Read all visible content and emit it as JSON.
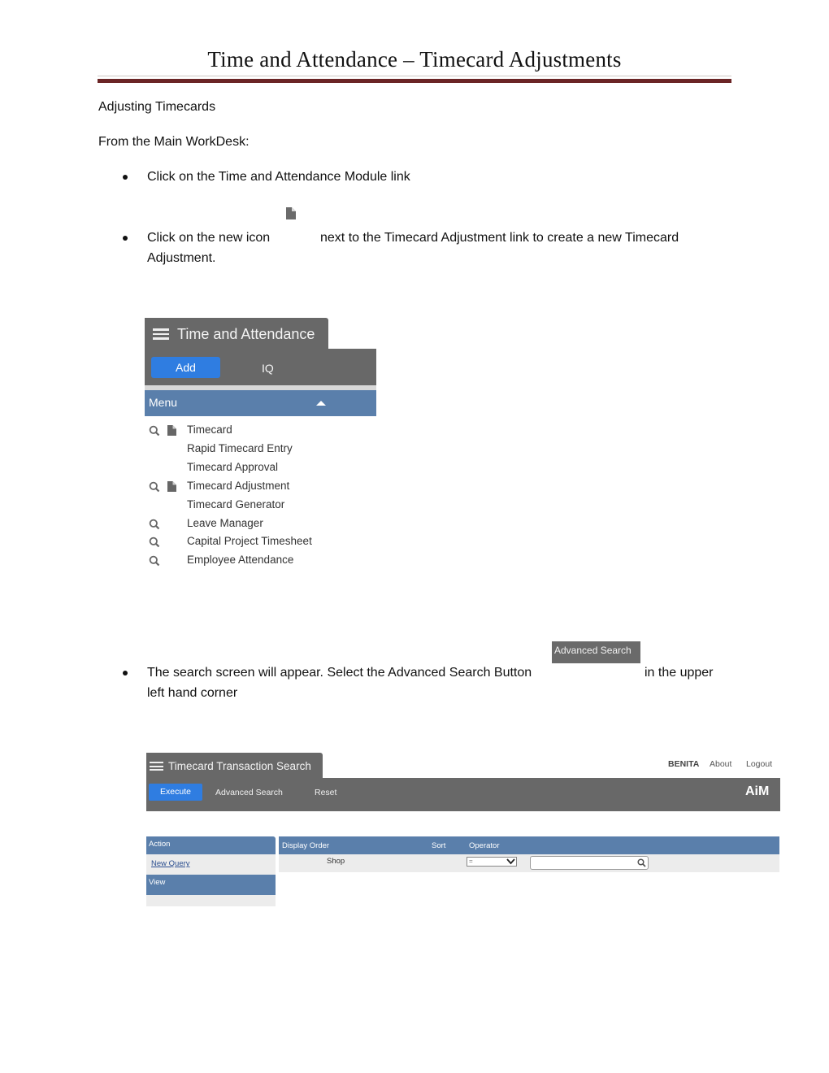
{
  "document": {
    "title": "Time and Attendance – Timecard Adjustments",
    "heading": "Adjusting Timecards",
    "intro": "From the Main WorkDesk:",
    "steps": [
      {
        "text": "Click on the Time and Attendance Module link"
      },
      {
        "text_line1_before": "Click on the new icon",
        "text_line1_after": "next to the Timecard Adjustment link to create a new Timecard",
        "text_line2": "Adjustment.",
        "inline_icon": "new-document-icon"
      },
      {
        "text_line1_before": "The search screen will appear.  Select the Advanced Search Button",
        "text_line1_after": "in the upper",
        "text_line2": "left hand corner",
        "inline_button_label": "Advanced Search"
      }
    ]
  },
  "ta_screenshot": {
    "title": "Time and Attendance",
    "add_label": "Add",
    "iq_label": "IQ",
    "menu_label": "Menu",
    "items": [
      {
        "label": "Timecard",
        "search": true,
        "new": true
      },
      {
        "label": "Rapid Timecard Entry",
        "search": false,
        "new": false
      },
      {
        "label": "Timecard Approval",
        "search": false,
        "new": false
      },
      {
        "label": "Timecard Adjustment",
        "search": true,
        "new": true
      },
      {
        "label": "Timecard Generator",
        "search": false,
        "new": false
      },
      {
        "label": "Leave Manager",
        "search": true,
        "new": false
      },
      {
        "label": "Capital Project Timesheet",
        "search": true,
        "new": false
      },
      {
        "label": "Employee Attendance",
        "search": true,
        "new": false
      }
    ]
  },
  "search_screenshot": {
    "title": "Timecard Transaction Search",
    "user": "BENITA",
    "about": "About",
    "logout": "Logout",
    "execute": "Execute",
    "advanced_search": "Advanced Search",
    "reset": "Reset",
    "brand": "AiM",
    "action_header": "Action",
    "new_query": "New Query",
    "view_header": "View",
    "columns": [
      "Display Order",
      "Sort",
      "Operator"
    ],
    "row": {
      "field": "Shop",
      "operator": "=",
      "value": ""
    }
  },
  "colors": {
    "title_rule": "#6b2526",
    "toolbar_gray": "#686868",
    "header_blue": "#5a7fab",
    "button_blue": "#2f7de1"
  }
}
